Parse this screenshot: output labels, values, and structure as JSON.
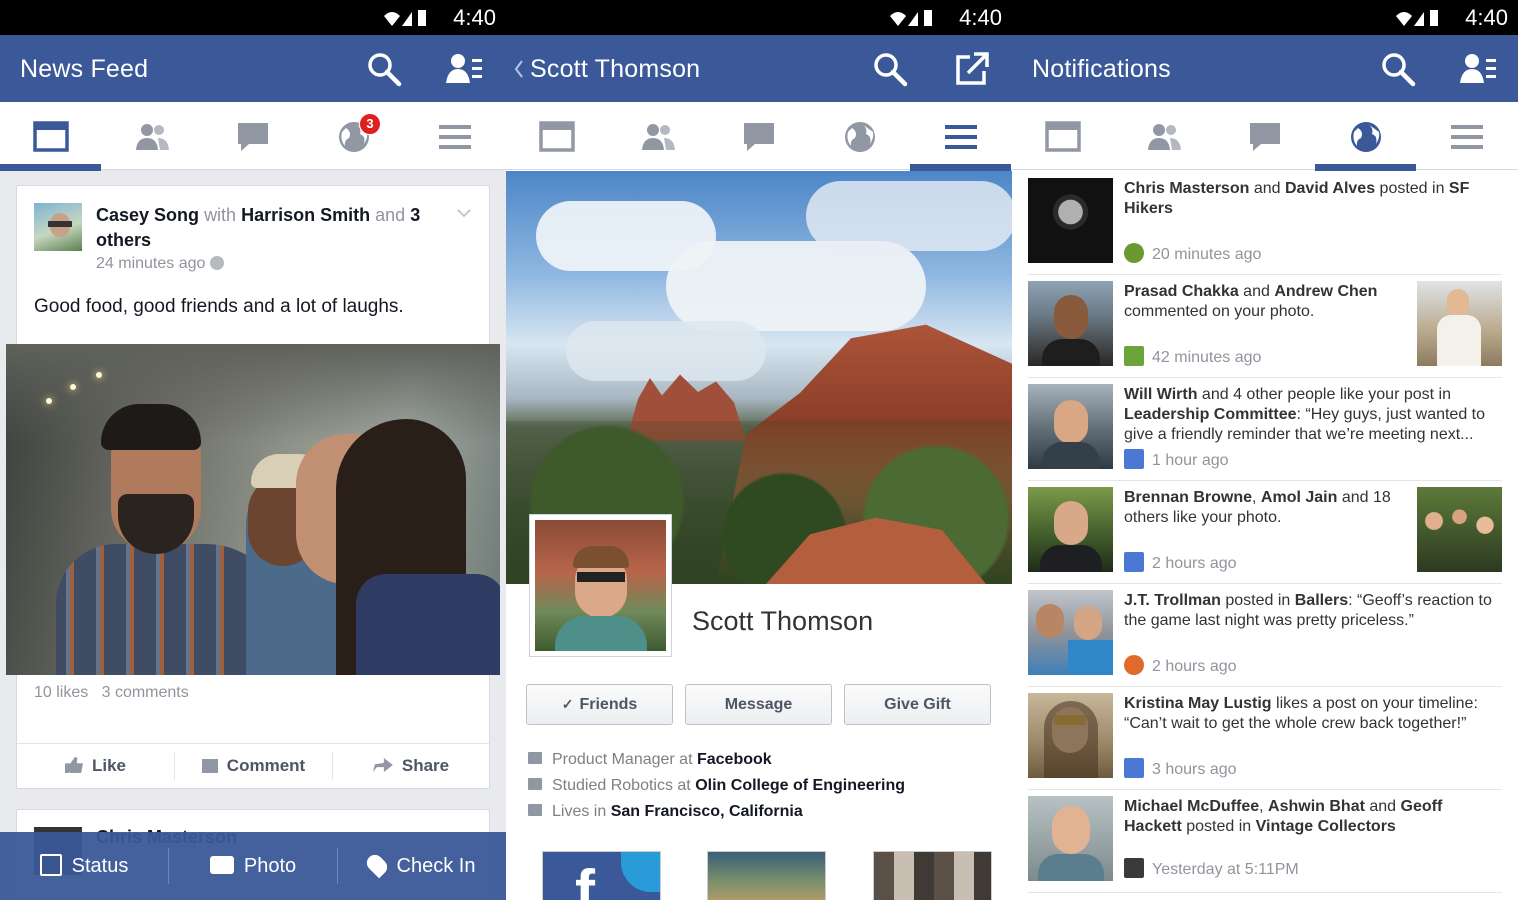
{
  "colors": {
    "brand": "#3b5998",
    "badge": "#e02020"
  },
  "status_time": "4:40",
  "feed": {
    "title": "News Feed",
    "badge_count": "3",
    "post": {
      "author": "Casey Song",
      "with_word": "with",
      "with_name": "Harrison Smith",
      "and_word": "and",
      "others": "3 others",
      "time": "24 minutes ago",
      "text": "Good food, good friends and a lot of laughs.",
      "likes": "10 likes",
      "comments": "3 comments",
      "actions": {
        "like": "Like",
        "comment": "Comment",
        "share": "Share"
      }
    },
    "next_post_author": "Chris Masterson",
    "bottom_bar": {
      "status": "Status",
      "photo": "Photo",
      "checkin": "Check In"
    }
  },
  "profile": {
    "back_icon": "chevron-left-icon",
    "title": "Scott Thomson",
    "name": "Scott Thomson",
    "buttons": {
      "friends": "Friends",
      "message": "Message",
      "gift": "Give Gift"
    },
    "work": {
      "label": "Product Manager at",
      "value": "Facebook"
    },
    "study": {
      "label": "Studied Robotics at",
      "value": "Olin College of Engineering"
    },
    "home": {
      "label": "Lives in",
      "value": "San Francisco, California"
    }
  },
  "notifications": {
    "title": "Notifications",
    "items": [
      {
        "a": "Chris Masterson",
        "b": " and ",
        "c": "David Alves",
        "d": " posted in ",
        "e": "SF Hikers",
        "f": "",
        "time": "20 minutes ago",
        "icon": "tree-icon"
      },
      {
        "a": "Prasad Chakka",
        "b": " and ",
        "c": "Andrew Chen",
        "d": " commented on your photo.",
        "e": "",
        "f": "",
        "time": "42 minutes ago",
        "icon": "comment-icon"
      },
      {
        "a": "Will Wirth",
        "b": " and 4 other people like your post in ",
        "c": "Leadership Committee",
        "d": ": “Hey guys, just wanted to give a friendly reminder that we’re meeting next...",
        "e": "",
        "f": "",
        "time": "1 hour ago",
        "icon": "like-icon"
      },
      {
        "a": "Brennan Browne",
        "b": ", ",
        "c": "Amol Jain",
        "d": " and 18 others like your photo.",
        "e": "",
        "f": "",
        "time": "2 hours ago",
        "icon": "like-icon"
      },
      {
        "a": "J.T. Trollman",
        "b": " posted in ",
        "c": "Ballers",
        "d": ": “Geoff’s reaction to the game last night was pretty priceless.”",
        "e": "",
        "f": "",
        "time": "2 hours ago",
        "icon": "basketball-icon"
      },
      {
        "a": "Kristina May Lustig",
        "b": " likes a post on your timeline: “Can’t wait to get the whole crew back together!”",
        "c": "",
        "d": "",
        "e": "",
        "f": "",
        "time": "3 hours ago",
        "icon": "like-icon"
      },
      {
        "a": "Michael McDuffee",
        "b": ", ",
        "c": "Ashwin Bhat",
        "d": " and ",
        "e": "Geoff Hackett",
        "f": " posted in ",
        "g": "Vintage Collectors",
        "time": "Yesterday at 5:11PM",
        "icon": "camera-icon"
      }
    ]
  }
}
